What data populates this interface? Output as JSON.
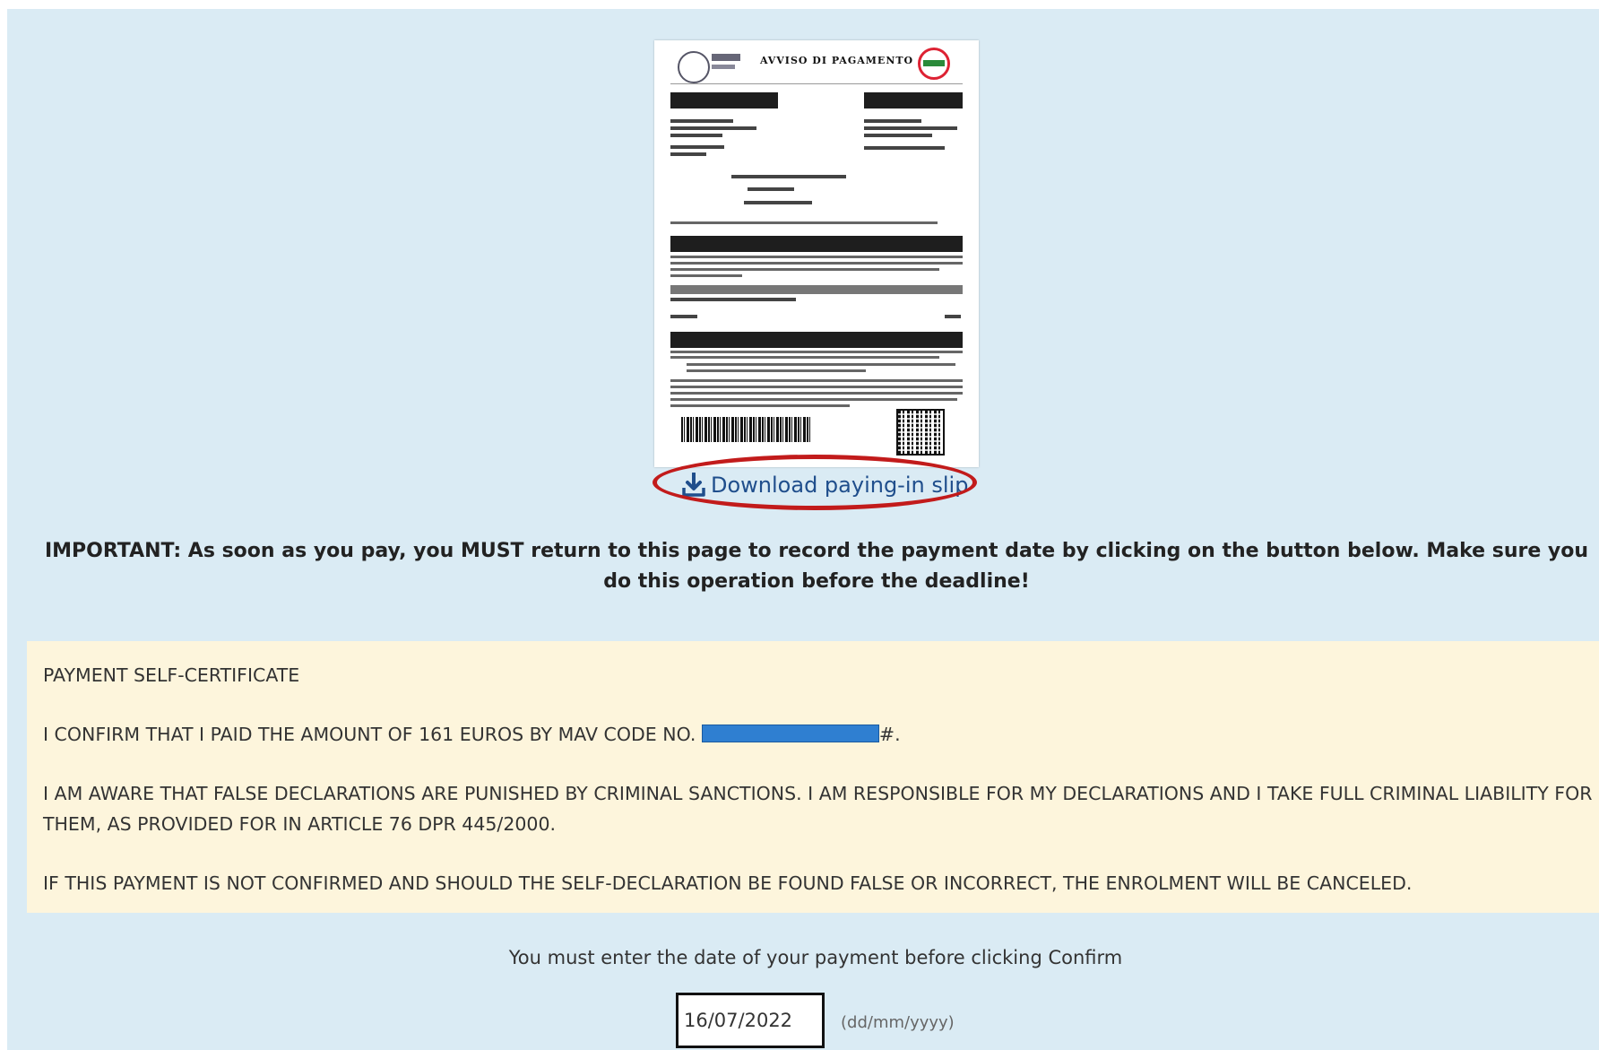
{
  "slip": {
    "title": "AVVISO DI PAGAMENTO"
  },
  "download": {
    "label": "Download paying-in slip",
    "icon": "download-icon"
  },
  "important_notice": "IMPORTANT: As soon as you pay, you MUST return to this page to record the payment date by clicking on the button below. Make sure you do this operation before the deadline!",
  "certificate": {
    "heading": "PAYMENT SELF-CERTIFICATE",
    "confirm_prefix": "I CONFIRM THAT I PAID THE AMOUNT OF 161 EUROS BY MAV CODE NO. ",
    "confirm_suffix": "#.",
    "awareness": "I AM AWARE THAT FALSE DECLARATIONS ARE PUNISHED BY CRIMINAL SANCTIONS. I AM RESPONSIBLE FOR MY DECLARATIONS AND I TAKE FULL CRIMINAL LIABILITY FOR THEM, AS PROVIDED FOR IN ARTICLE 76 DPR 445/2000.",
    "warning": "IF THIS PAYMENT IS NOT CONFIRMED AND SHOULD THE SELF-DECLARATION BE FOUND FALSE OR INCORRECT, THE ENROLMENT WILL BE CANCELED."
  },
  "payment_date": {
    "instruction": "You must enter the date of your payment before clicking Confirm",
    "value": "16/07/2022",
    "format_hint": "(dd/mm/yyyy)"
  },
  "colors": {
    "panel_bg": "#daebf4",
    "certificate_bg": "#fdf5dc",
    "link": "#1f4e8c",
    "highlight_ring": "#c21b1b",
    "redaction": "#2f7fd1"
  }
}
